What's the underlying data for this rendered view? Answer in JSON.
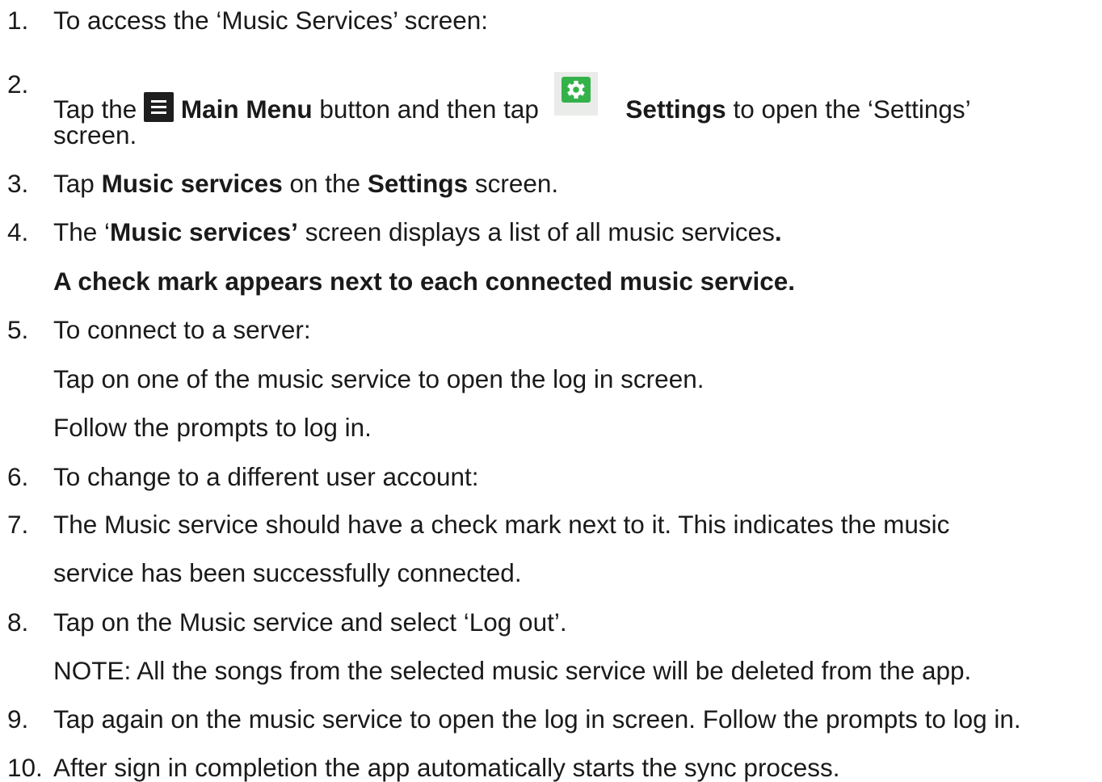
{
  "steps": [
    {
      "num": "1.",
      "text": "To access the ‘Music Services’ screen:"
    },
    {
      "num": "2.",
      "tap": "Tap the",
      "main_menu": "Main Menu",
      "middle": "button and then tap",
      "settings": "Settings",
      "end": "to open the ‘Settings’",
      "cont": "screen."
    },
    {
      "num": "3.",
      "tap": "Tap",
      "music_services": "Music services",
      "on_the": "on the",
      "settings": "Settings",
      "end": "screen."
    },
    {
      "num": "4.",
      "the": "The ‘",
      "music_services": "Music services’",
      "end": "screen displays a list of all music services",
      "period": ".",
      "bold_line": "A check mark appears next to each connected music service."
    },
    {
      "num": "5.",
      "text": "To connect to a server:",
      "line2": "Tap on one of the music service to open the log in screen.",
      "line3": "Follow the prompts to log in."
    },
    {
      "num": "6.",
      "text": "To change to a different user account:"
    },
    {
      "num": "7.",
      "text": "The Music service should have a check mark next to it. This indicates the music",
      "cont": "service has been successfully connected."
    },
    {
      "num": "8.",
      "text": "Tap on the Music service and select ‘Log out’.",
      "note": "NOTE: All the songs from the selected music service will be deleted from the app."
    },
    {
      "num": "9.",
      "text": "Tap again on the music service to open the log in screen. Follow the prompts to log in."
    },
    {
      "num": "10.",
      "text": "After sign in completion the app automatically starts the sync process."
    }
  ],
  "icons": {
    "main_menu": "hamburger-menu-icon",
    "settings": "settings-gear-icon",
    "settings_color": "#34b24a"
  }
}
